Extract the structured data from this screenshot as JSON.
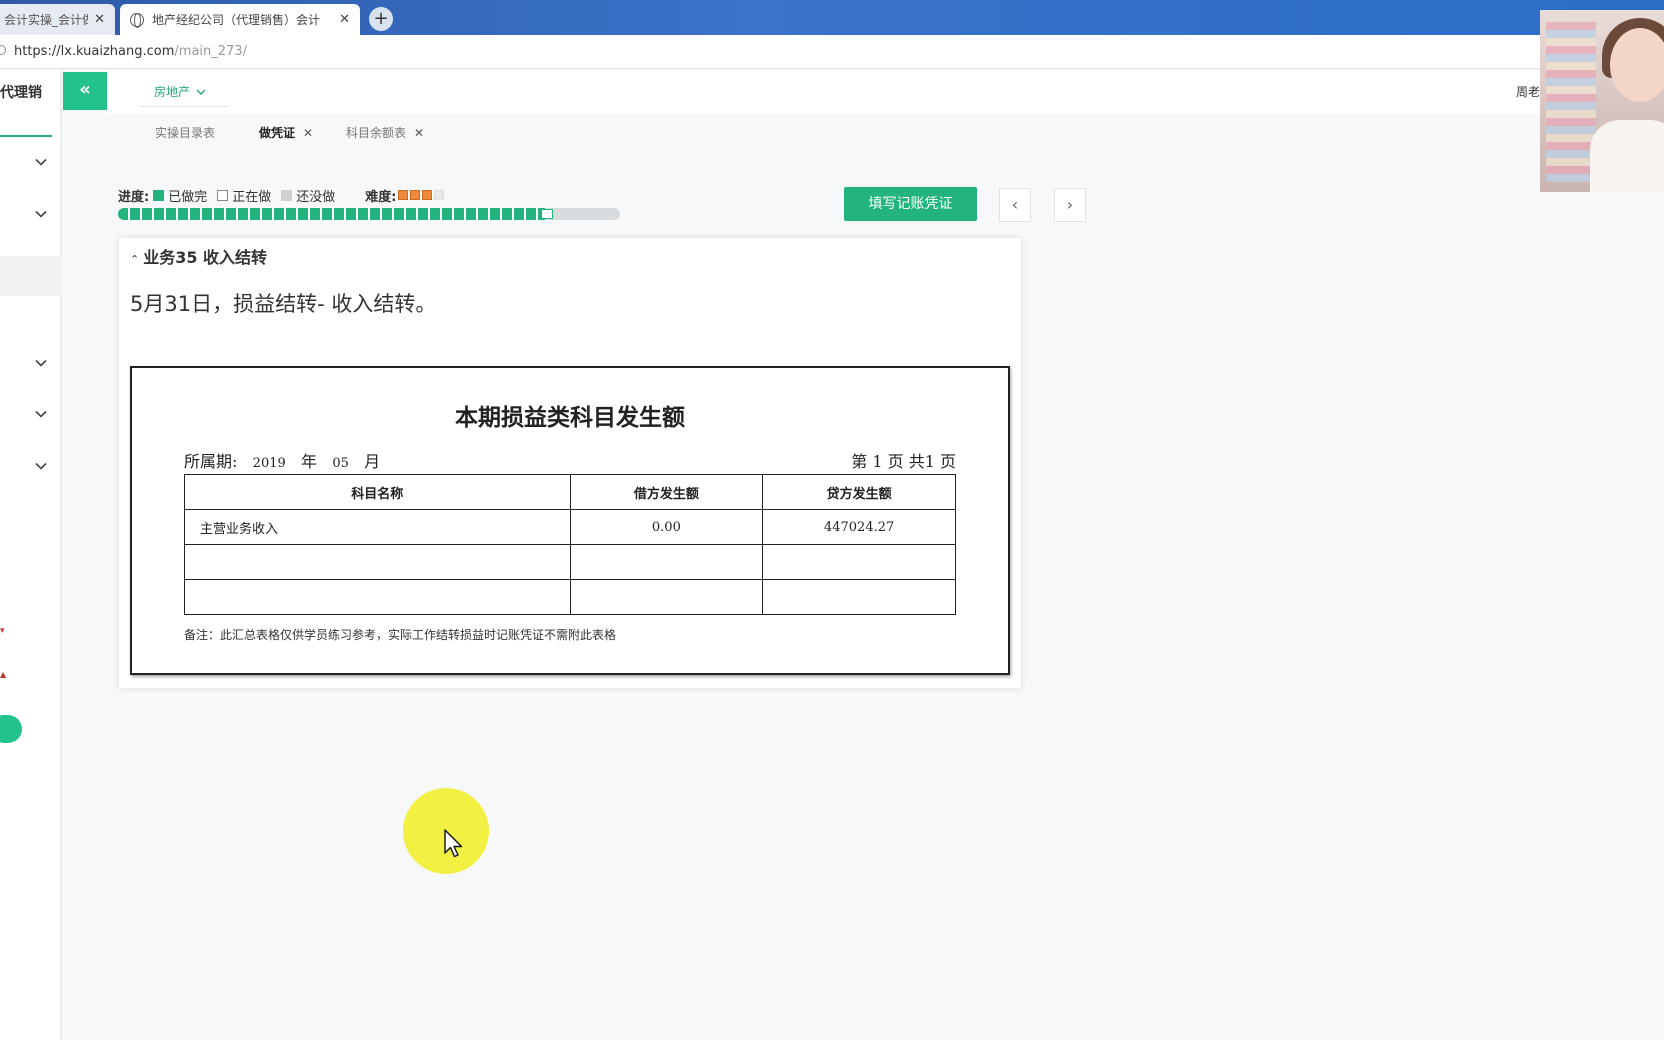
{
  "browser": {
    "tabs": [
      {
        "label": "会计实操_会计做"
      },
      {
        "label": "地产经纪公司（代理销售）会计"
      }
    ],
    "new_tab": "+",
    "url": {
      "host": "https://lx.kuaizhang.com",
      "path": "/main_273/"
    }
  },
  "sidebar": {
    "brand": "代理销"
  },
  "topbar": {
    "collapse_icon": "«",
    "department": "房地产",
    "teacher": "周老师"
  },
  "subtabs": [
    {
      "label": "实操目录表",
      "closable": false
    },
    {
      "label": "做凭证",
      "closable": true
    },
    {
      "label": "科目余额表",
      "closable": true
    }
  ],
  "progress": {
    "label": "进度:",
    "done": "已做完",
    "doing": "正在做",
    "todo": "还没做",
    "difficulty_label": "难度:",
    "difficulty_stars": 3,
    "difficulty_max": 4,
    "completion": 0.85
  },
  "actions": {
    "fill_voucher": "填写记账凭证",
    "prev": "‹",
    "next": "›"
  },
  "task": {
    "title": "业务35 收入结转",
    "description": "5月31日，损益结转- 收入结转。"
  },
  "document": {
    "title": "本期损益类科目发生额",
    "period_label": "所属期:",
    "year": "2019",
    "year_unit": "年",
    "month": "05",
    "month_unit": "月",
    "page_text": "第 1 页 共1 页",
    "headers": [
      "科目名称",
      "借方发生额",
      "贷方发生额"
    ],
    "rows": [
      [
        "主营业务收入",
        "0.00",
        "447024.27"
      ],
      [
        "",
        "",
        ""
      ],
      [
        "",
        "",
        ""
      ]
    ],
    "note": "备注：此汇总表格仅供学员练习参考，实际工作结转损益时记账凭证不需附此表格"
  },
  "colors": {
    "accent": "#23b37c",
    "browser_bar": "#3a73c9",
    "star": "#f08b3d"
  }
}
